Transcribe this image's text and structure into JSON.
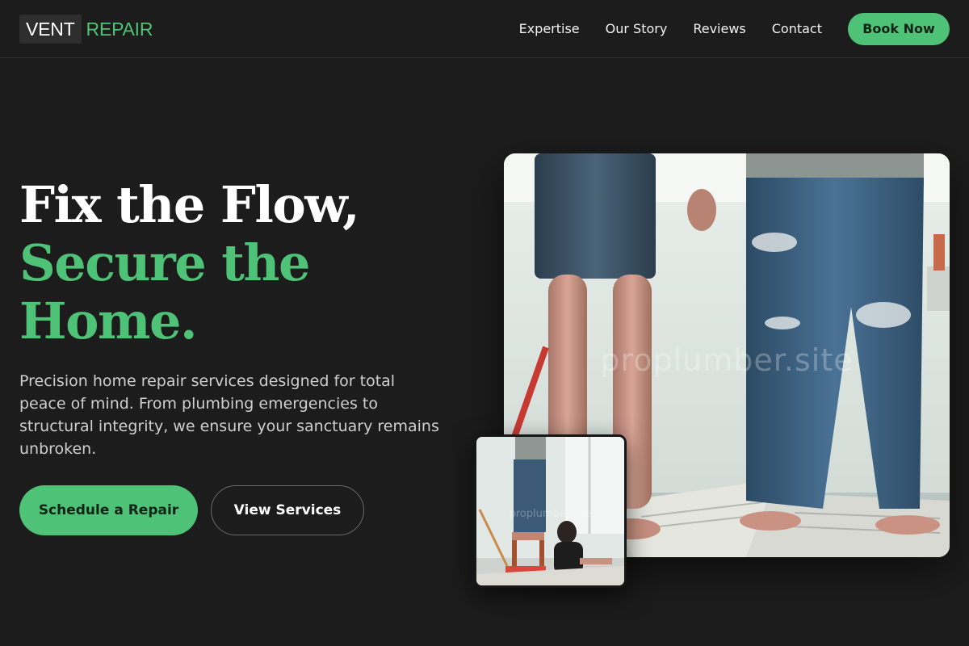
{
  "brand": {
    "logo_primary": "VENT",
    "logo_accent": "REPAIR",
    "accent_color": "#4ec276",
    "background_color": "#1c1c1c"
  },
  "nav": {
    "links": [
      {
        "label": "Expertise"
      },
      {
        "label": "Our Story"
      },
      {
        "label": "Reviews"
      },
      {
        "label": "Contact"
      }
    ],
    "cta_label": "Book Now"
  },
  "hero": {
    "headline_line1": "Fix the Flow,",
    "headline_line2": "Secure the",
    "headline_line3": "Home.",
    "description": "Precision home repair services designed for total peace of mind. From plumbing emergencies to structural integrity, we ensure your sanctuary remains unbroken.",
    "primary_button": "Schedule a Repair",
    "secondary_button": "View Services",
    "main_image_watermark": "proplumber.site",
    "thumb_image_watermark": "proplumber.site"
  }
}
